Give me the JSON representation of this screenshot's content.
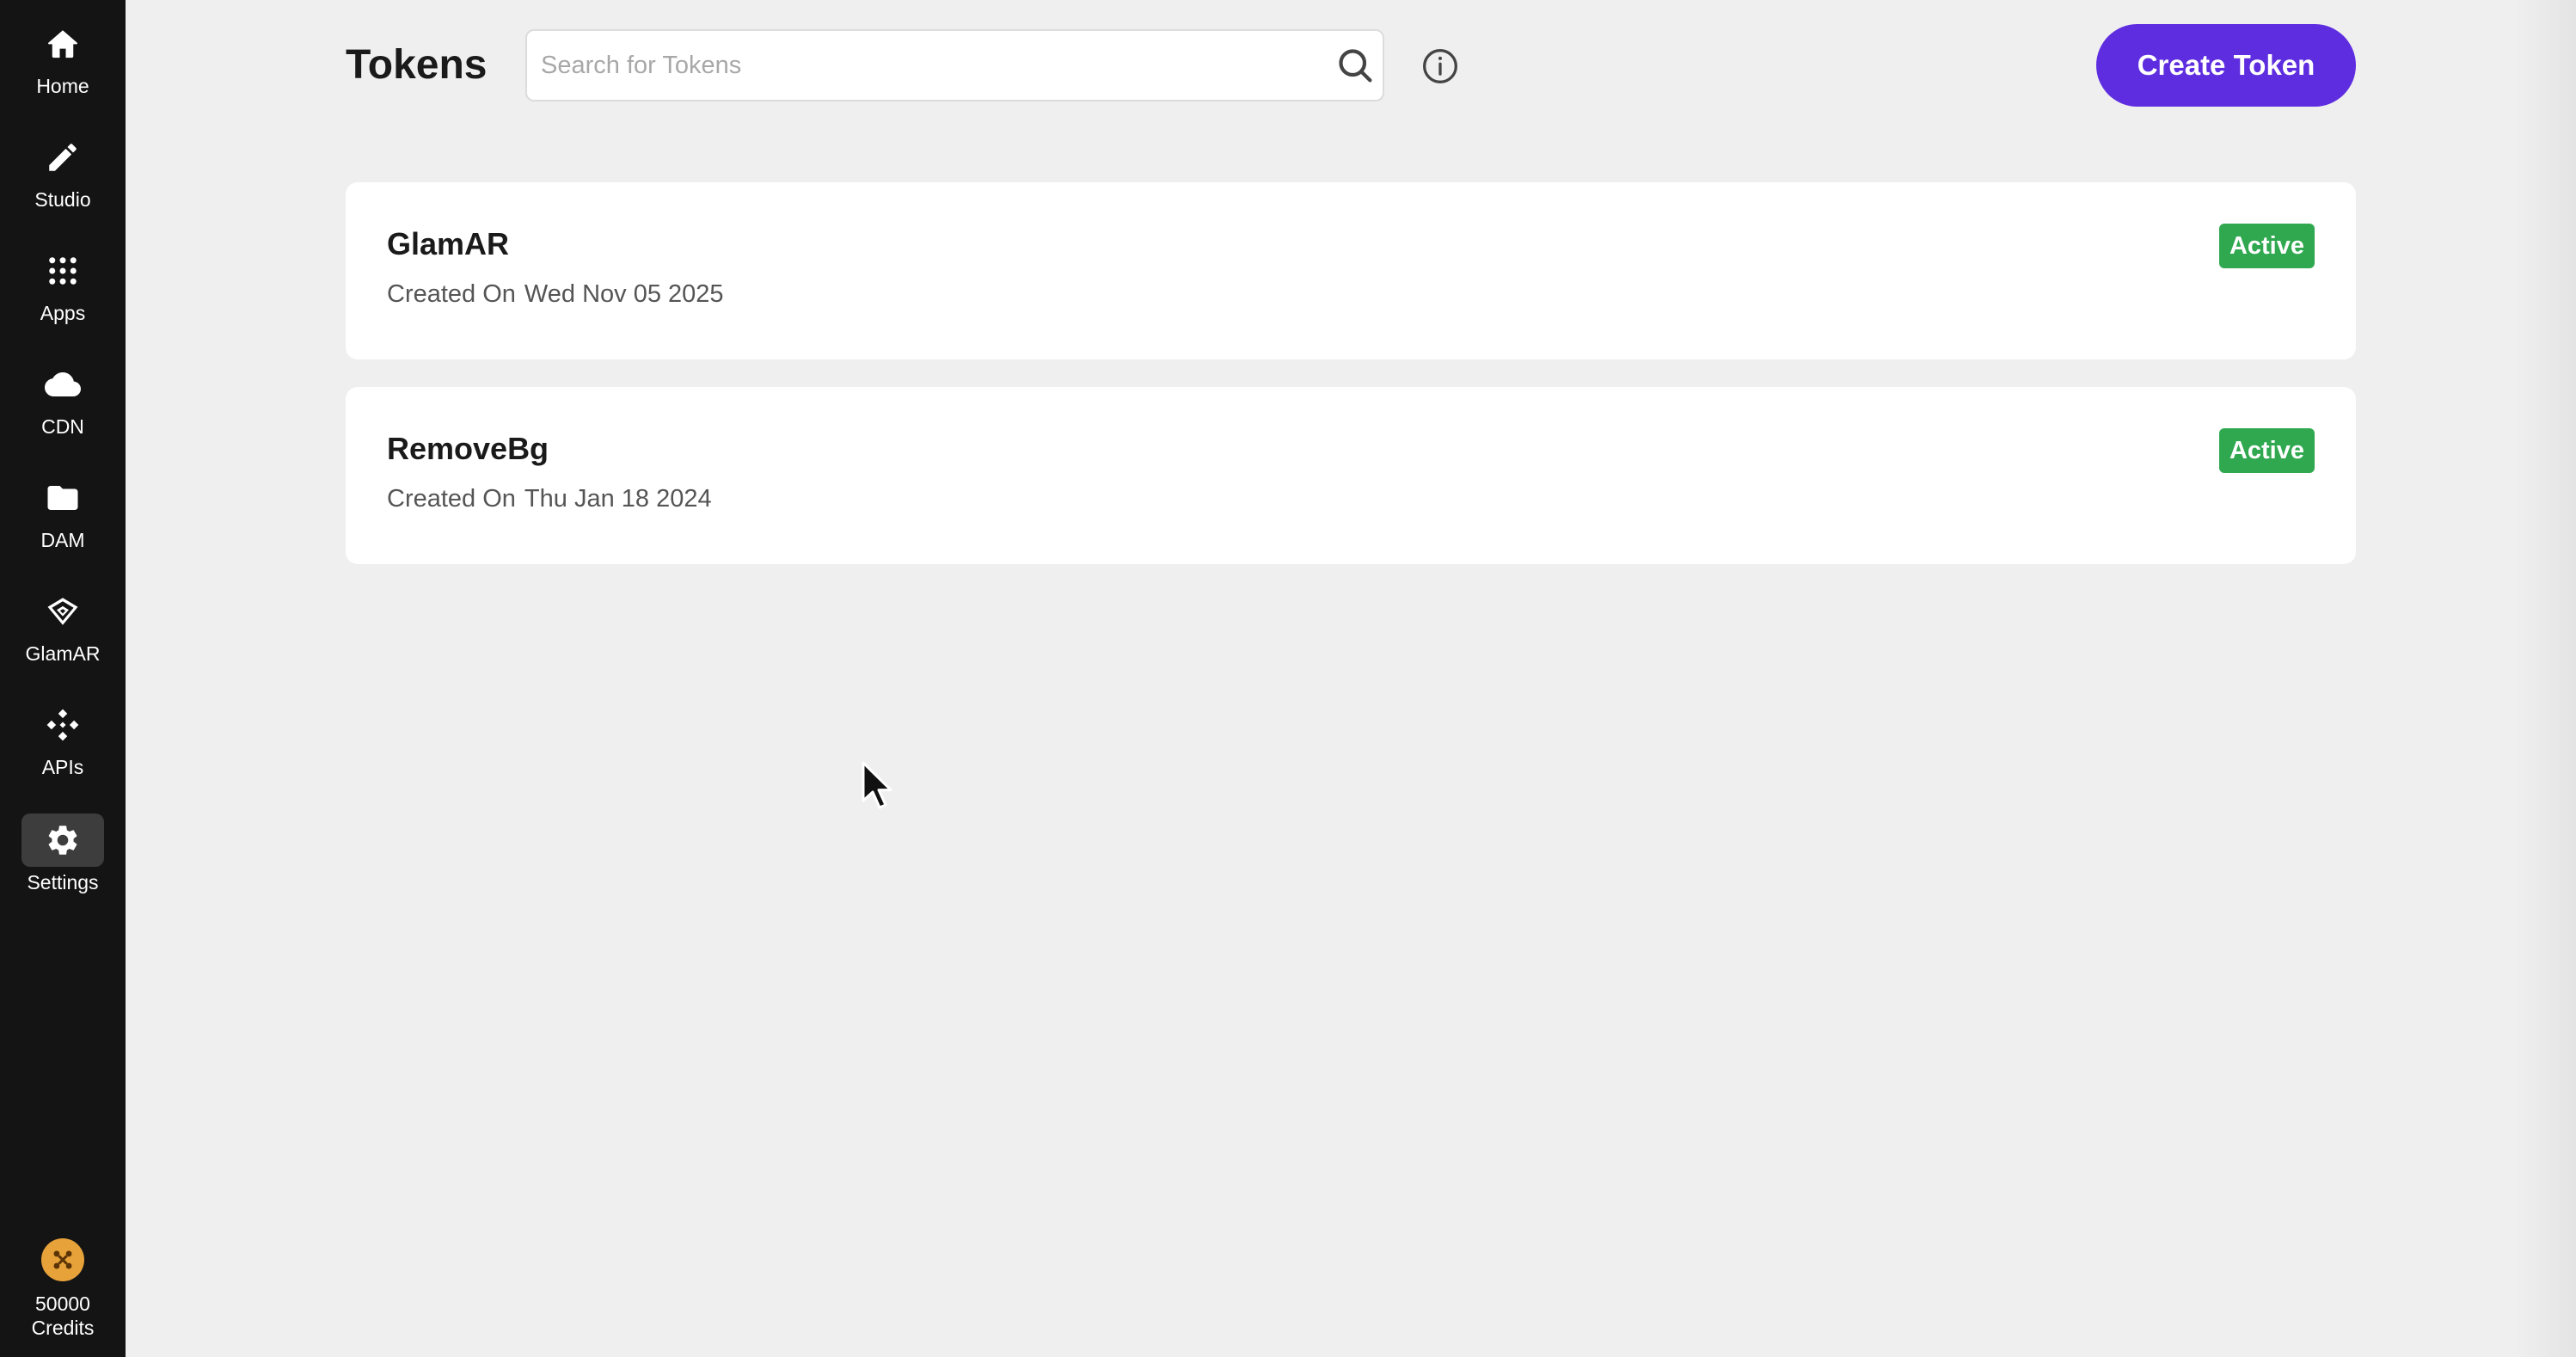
{
  "sidebar": {
    "items": [
      {
        "label": "Home",
        "icon": "home-icon"
      },
      {
        "label": "Studio",
        "icon": "pencil-icon"
      },
      {
        "label": "Apps",
        "icon": "grid-icon"
      },
      {
        "label": "CDN",
        "icon": "cloud-icon"
      },
      {
        "label": "DAM",
        "icon": "folder-icon"
      },
      {
        "label": "GlamAR",
        "icon": "glamar-icon"
      },
      {
        "label": "APIs",
        "icon": "apis-icon"
      },
      {
        "label": "Settings",
        "icon": "gear-icon",
        "active": true
      }
    ],
    "credits": {
      "label": "50000\nCredits",
      "icon": "coin-icon",
      "color": "#e7a23a"
    }
  },
  "header": {
    "title": "Tokens",
    "search": {
      "placeholder": "Search for Tokens",
      "value": ""
    },
    "create_label": "Create Token"
  },
  "tokens": [
    {
      "name": "GlamAR",
      "created_label": "Created On",
      "created_date": "Wed Nov 05 2025",
      "status": "Active"
    },
    {
      "name": "RemoveBg",
      "created_label": "Created On",
      "created_date": "Thu Jan 18 2024",
      "status": "Active"
    }
  ],
  "colors": {
    "accent": "#5e2de0",
    "status_active": "#2fa84f",
    "sidebar_bg": "#141414",
    "page_bg": "#efefef"
  }
}
